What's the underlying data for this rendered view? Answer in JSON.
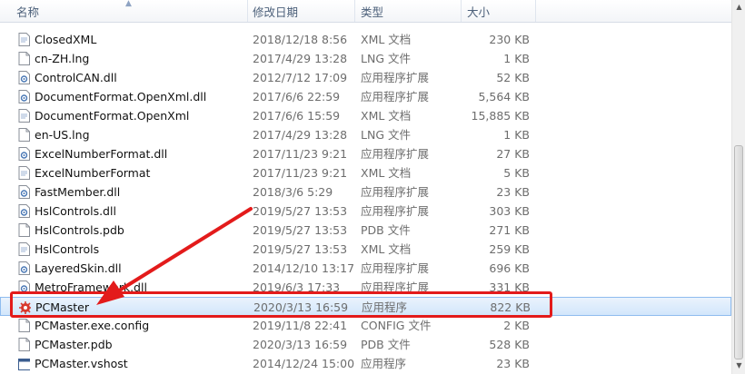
{
  "header": {
    "name": "名称",
    "date": "修改日期",
    "type": "类型",
    "size": "大小"
  },
  "files": [
    {
      "name": "ClosedXML",
      "date": "2018/12/18 8:56",
      "type": "XML 文档",
      "size": "230 KB",
      "icon": "xml-document-icon"
    },
    {
      "name": "cn-ZH.lng",
      "date": "2017/4/29 13:28",
      "type": "LNG 文件",
      "size": "1 KB",
      "icon": "blank-file-icon"
    },
    {
      "name": "ControlCAN.dll",
      "date": "2012/7/12 17:09",
      "type": "应用程序扩展",
      "size": "52 KB",
      "icon": "dll-file-icon"
    },
    {
      "name": "DocumentFormat.OpenXml.dll",
      "date": "2017/6/6 22:59",
      "type": "应用程序扩展",
      "size": "5,564 KB",
      "icon": "dll-file-icon"
    },
    {
      "name": "DocumentFormat.OpenXml",
      "date": "2017/6/6 15:59",
      "type": "XML 文档",
      "size": "15,885 KB",
      "icon": "xml-document-icon"
    },
    {
      "name": "en-US.lng",
      "date": "2017/4/29 13:28",
      "type": "LNG 文件",
      "size": "1 KB",
      "icon": "blank-file-icon"
    },
    {
      "name": "ExcelNumberFormat.dll",
      "date": "2017/11/23 9:21",
      "type": "应用程序扩展",
      "size": "27 KB",
      "icon": "dll-file-icon"
    },
    {
      "name": "ExcelNumberFormat",
      "date": "2017/11/23 9:21",
      "type": "XML 文档",
      "size": "5 KB",
      "icon": "xml-document-icon"
    },
    {
      "name": "FastMember.dll",
      "date": "2018/3/6 5:29",
      "type": "应用程序扩展",
      "size": "23 KB",
      "icon": "dll-file-icon"
    },
    {
      "name": "HslControls.dll",
      "date": "2019/5/27 13:53",
      "type": "应用程序扩展",
      "size": "303 KB",
      "icon": "dll-file-icon"
    },
    {
      "name": "HslControls.pdb",
      "date": "2019/5/27 13:53",
      "type": "PDB 文件",
      "size": "271 KB",
      "icon": "blank-file-icon"
    },
    {
      "name": "HslControls",
      "date": "2019/5/27 13:53",
      "type": "XML 文档",
      "size": "259 KB",
      "icon": "xml-document-icon"
    },
    {
      "name": "LayeredSkin.dll",
      "date": "2014/12/10 13:17",
      "type": "应用程序扩展",
      "size": "696 KB",
      "icon": "dll-file-icon"
    },
    {
      "name": "MetroFramework.dll",
      "date": "2019/6/3 17:33",
      "type": "应用程序扩展",
      "size": "331 KB",
      "icon": "dll-file-icon"
    },
    {
      "name": "PCMaster",
      "date": "2020/3/13 16:59",
      "type": "应用程序",
      "size": "822 KB",
      "icon": "application-gear-icon",
      "selected": true
    },
    {
      "name": "PCMaster.exe.config",
      "date": "2019/11/8 22:41",
      "type": "CONFIG 文件",
      "size": "2 KB",
      "icon": "blank-file-icon"
    },
    {
      "name": "PCMaster.pdb",
      "date": "2020/3/13 16:59",
      "type": "PDB 文件",
      "size": "528 KB",
      "icon": "blank-file-icon"
    },
    {
      "name": "PCMaster.vshost",
      "date": "2014/12/24 15:00",
      "type": "应用程序",
      "size": "23 KB",
      "icon": "application-window-icon"
    }
  ],
  "colors": {
    "annotation": "#e31b1b",
    "selection": "#d2e6fb"
  }
}
